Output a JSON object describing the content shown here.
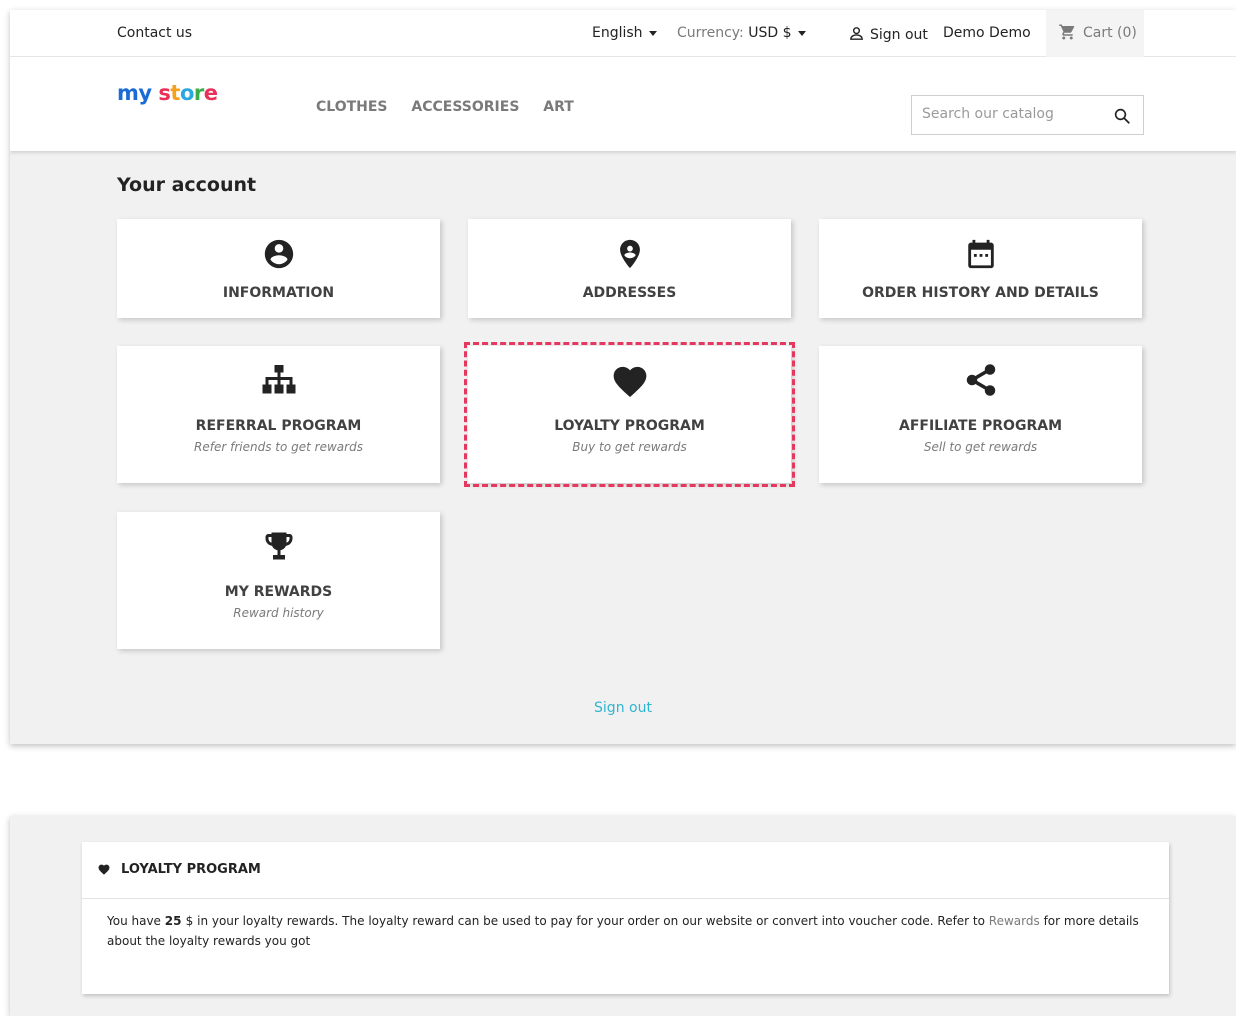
{
  "topbar": {
    "contact": "Contact us",
    "language": "English",
    "currency_label": "Currency:",
    "currency_value": "USD $",
    "sign_out": "Sign out",
    "user": "Demo Demo",
    "cart": "Cart (0)"
  },
  "header": {
    "logo": {
      "part1": "my",
      "part2": "s",
      "part3": "t",
      "part4": "o",
      "part5": "r",
      "part6": "e"
    },
    "nav": [
      "CLOTHES",
      "ACCESSORIES",
      "ART"
    ],
    "search_placeholder": "Search our catalog"
  },
  "page_title": "Your account",
  "cards": [
    {
      "title": "INFORMATION",
      "icon": "account-circle-icon"
    },
    {
      "title": "ADDRESSES",
      "icon": "location-pin-icon"
    },
    {
      "title": "ORDER HISTORY AND DETAILS",
      "icon": "calendar-icon"
    },
    {
      "title": "REFERRAL PROGRAM",
      "subtitle": "Refer friends to get rewards",
      "icon": "sitemap-icon"
    },
    {
      "title": "LOYALTY PROGRAM",
      "subtitle": "Buy to get rewards",
      "icon": "heart-icon"
    },
    {
      "title": "AFFILIATE PROGRAM",
      "subtitle": "Sell to get rewards",
      "icon": "share-icon"
    },
    {
      "title": "MY REWARDS",
      "subtitle": "Reward history",
      "icon": "trophy-icon"
    }
  ],
  "sign_out_link": "Sign out",
  "highlight_color": "#e5385e",
  "loyalty": {
    "heading": "LOYALTY PROGRAM",
    "text_before": "You have ",
    "amount": "25 ",
    "text_middle": "$ in your loyalty rewards. The loyalty reward can be used to pay for your order on our website or convert into voucher code. Refer to ",
    "rewards_link": "Rewards",
    "text_after": " for more details about the loyalty rewards you got"
  }
}
